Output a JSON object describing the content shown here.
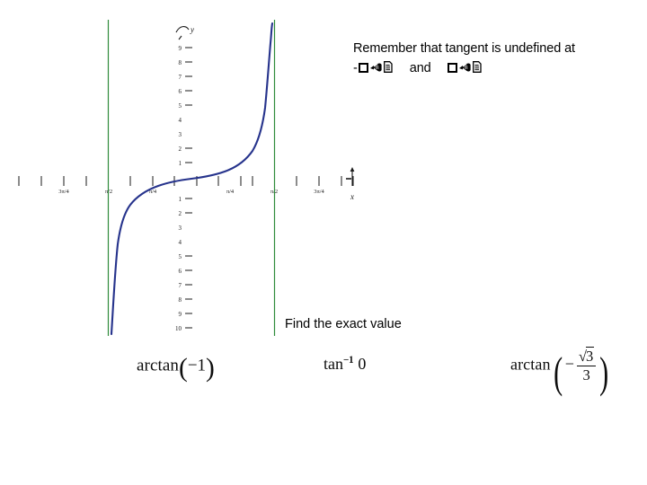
{
  "slide": {
    "background": "#ffffff",
    "note": {
      "line1": "Remember that tangent is undefined at",
      "and_label": "and",
      "minus": "-",
      "tofu_icons": [
        "filled-box-glyph",
        "hand-pointing-glyph",
        "document-glyph"
      ]
    },
    "prompt": "Find the exact value",
    "expressions": [
      {
        "id": "expr-1",
        "text": "arctan(-1)",
        "func": "arctan",
        "open_paren": "(",
        "minus": "−",
        "argument": "1",
        "close_paren": ")"
      },
      {
        "id": "expr-2",
        "text": "tan^-1 0",
        "func": "tan",
        "exponent": "−1",
        "argument": "0"
      },
      {
        "id": "expr-3",
        "text": "arctan(-sqrt(3)/3)",
        "func": "arctan",
        "open_paren": "(",
        "minus": "−",
        "radical": "√",
        "numerator": "3",
        "denominator": "3",
        "close_paren": ")"
      }
    ]
  },
  "chart_data": {
    "type": "line",
    "title": "",
    "function": "y = tan(x)",
    "xlabel": "x",
    "ylabel": "y",
    "xlim": [
      -3.9269908,
      3.9269908
    ],
    "ylim": [
      -10,
      10
    ],
    "grid": false,
    "legend": null,
    "series": [
      {
        "name": "tan(x)",
        "color": "#26338c",
        "branch_domain": [
          -1.5707963,
          1.5707963
        ],
        "x": [
          -1.53,
          -1.5,
          -1.45,
          -1.4,
          -1.3,
          -1.2,
          -1.1,
          -1.0,
          -0.9,
          -0.8,
          -0.7,
          -0.6,
          -0.5,
          -0.4,
          -0.3,
          -0.2,
          -0.1,
          0.0,
          0.1,
          0.2,
          0.3,
          0.4,
          0.5,
          0.6,
          0.7,
          0.8,
          0.9,
          1.0,
          1.1,
          1.2,
          1.3,
          1.4,
          1.45,
          1.5,
          1.53
        ],
        "y": [
          -24.5,
          -14.1,
          -8.24,
          -5.8,
          -3.6,
          -2.57,
          -1.96,
          -1.56,
          -1.26,
          -1.03,
          -0.84,
          -0.68,
          -0.55,
          -0.42,
          -0.31,
          -0.2,
          -0.1,
          0.0,
          0.1,
          0.2,
          0.31,
          0.42,
          0.55,
          0.68,
          0.84,
          1.03,
          1.26,
          1.56,
          1.96,
          2.57,
          3.6,
          5.8,
          8.24,
          14.1,
          24.5
        ]
      }
    ],
    "asymptotes": {
      "color": "#2e8b3a",
      "x_values": [
        -1.5707963,
        1.5707963
      ],
      "labels": [
        "-π/2",
        "π/2"
      ]
    },
    "x_ticks": [
      {
        "value": -3.1415927,
        "label": ""
      },
      {
        "value": -2.7488936,
        "label": ""
      },
      {
        "value": -2.3561945,
        "label": "3π/4"
      },
      {
        "value": -1.9634954,
        "label": ""
      },
      {
        "value": -1.5707963,
        "label": "π/2"
      },
      {
        "value": -1.1780972,
        "label": ""
      },
      {
        "value": -0.7853982,
        "label": "π/4"
      },
      {
        "value": -0.3926991,
        "label": ""
      },
      {
        "value": 0.3926991,
        "label": ""
      },
      {
        "value": 0.7853982,
        "label": "π/4"
      },
      {
        "value": 1.1780972,
        "label": ""
      },
      {
        "value": 1.5707963,
        "label": "π/2"
      },
      {
        "value": 1.9634954,
        "label": ""
      },
      {
        "value": 2.3561945,
        "label": "3π/4"
      },
      {
        "value": 2.7488936,
        "label": ""
      },
      {
        "value": 3.1415927,
        "label": ""
      }
    ],
    "y_ticks_positive": [
      9,
      8,
      7,
      6,
      5,
      4,
      3,
      2,
      1
    ],
    "y_ticks_negative": [
      1,
      2,
      3,
      4,
      5,
      6,
      7,
      8,
      9,
      10
    ],
    "y_tick_labels_positive": [
      "9",
      "8",
      "7",
      "6",
      "5",
      "4",
      "3",
      "2",
      "1"
    ],
    "y_tick_labels_negative": [
      "1",
      "2",
      "3",
      "4",
      "5",
      "6",
      "7",
      "8",
      "9",
      "10"
    ]
  }
}
